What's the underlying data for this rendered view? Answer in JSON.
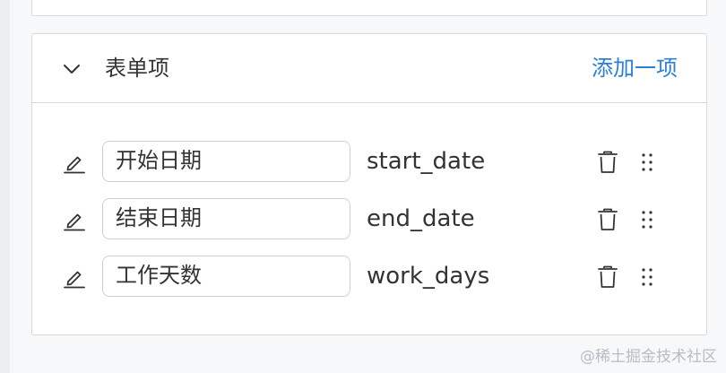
{
  "section": {
    "title": "表单项",
    "add_label": "添加一项",
    "accent_color": "#2b7fd6"
  },
  "fields": [
    {
      "label": "开始日期",
      "key": "start_date"
    },
    {
      "label": "结束日期",
      "key": "end_date"
    },
    {
      "label": "工作天数",
      "key": "work_days"
    }
  ],
  "icons": {
    "collapse": "chevron-down-icon",
    "edit": "pencil-icon",
    "delete": "trash-icon",
    "drag": "drag-handle-icon"
  },
  "watermark": "@稀土掘金技术社区"
}
